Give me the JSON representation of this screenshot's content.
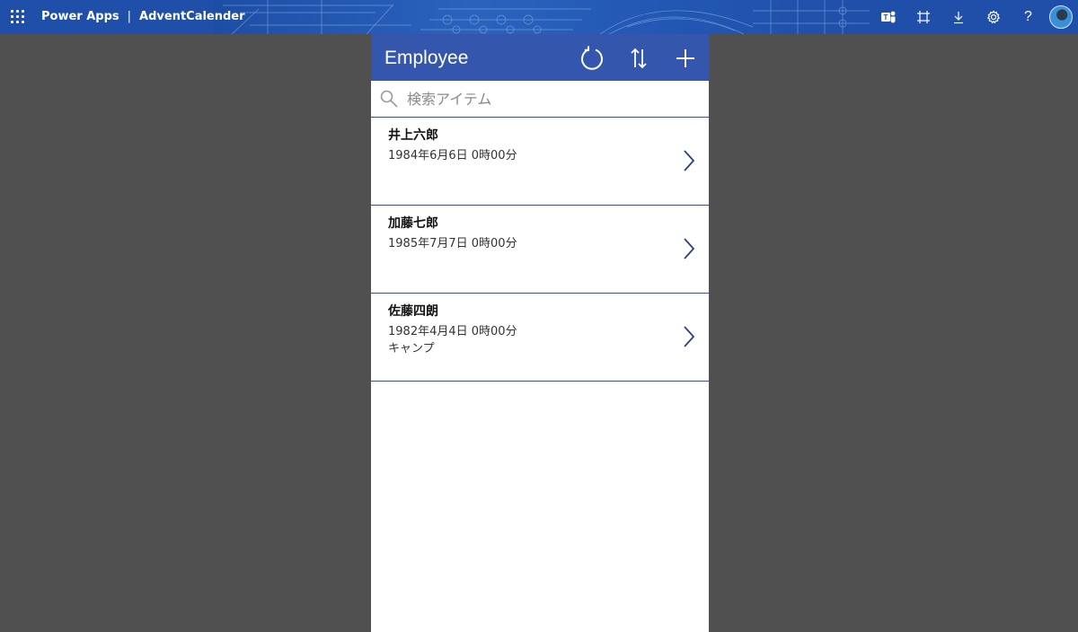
{
  "topbar": {
    "product": "Power Apps",
    "separator": "|",
    "app_name": "AdventCalender",
    "icons": [
      "teams-icon",
      "fit-to-window-icon",
      "download-icon",
      "settings-icon",
      "help-icon",
      "user-avatar"
    ],
    "help_glyph": "?"
  },
  "app": {
    "title": "Employee",
    "header_buttons": [
      "refresh-icon",
      "sort-icon",
      "add-icon"
    ],
    "search": {
      "placeholder": "検索アイテム",
      "value": ""
    },
    "items": [
      {
        "name": "井上六郎",
        "date": "1984年6月6日 0時00分",
        "extra": ""
      },
      {
        "name": "加藤七郎",
        "date": "1985年7月7日 0時00分",
        "extra": ""
      },
      {
        "name": "佐藤四朗",
        "date": "1982年4月4日 0時00分",
        "extra": "キャンプ"
      }
    ]
  },
  "colors": {
    "topbar": "#1f4fa8",
    "app_header": "#3457ad",
    "divider": "#3f4f86",
    "backdrop": "#505050"
  }
}
